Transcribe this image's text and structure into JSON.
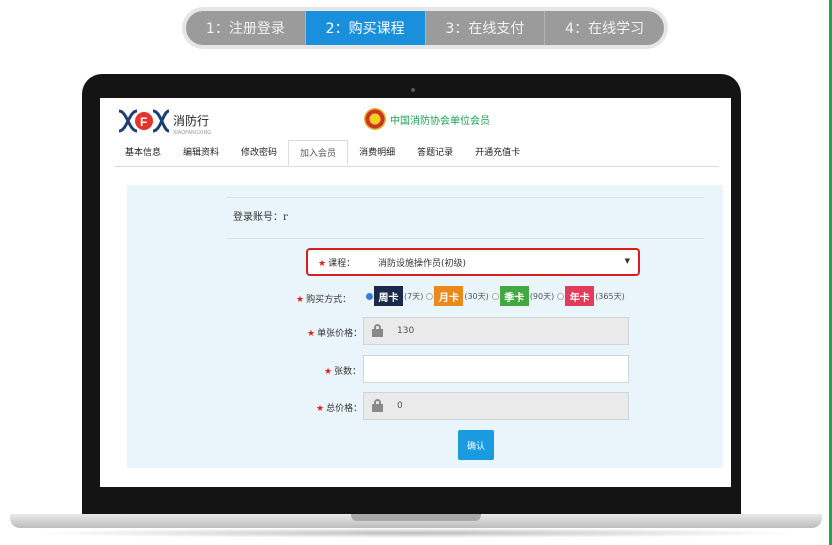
{
  "steps": [
    {
      "label": "1：注册登录"
    },
    {
      "label": "2：购买课程"
    },
    {
      "label": "3：在线支付"
    },
    {
      "label": "4：在线学习"
    }
  ],
  "site": {
    "logo_text": "消防行",
    "logo_sub": "XIAOFANGXING",
    "member_text": "中国消防协会单位会员"
  },
  "nav": {
    "tabs": [
      {
        "label": "基本信息"
      },
      {
        "label": "编辑资料"
      },
      {
        "label": "修改密码"
      },
      {
        "label": "加入会员"
      },
      {
        "label": "消费明细"
      },
      {
        "label": "答题记录"
      },
      {
        "label": "开通充值卡"
      }
    ]
  },
  "form": {
    "account_label": "登录账号：",
    "account_value": "r",
    "course_label": "课程：",
    "course_value": "消防设施操作员(初级)",
    "purchase_label": "购买方式：",
    "purchase_options": [
      {
        "card": "周卡",
        "duration": "(7天)"
      },
      {
        "card": "月卡",
        "duration": "(30天)"
      },
      {
        "card": "季卡",
        "duration": "(90天)"
      },
      {
        "card": "年卡",
        "duration": "(365天)"
      }
    ],
    "unit_price_label": "单张价格：",
    "unit_price_value": "130",
    "quantity_label": "张数：",
    "quantity_value": "",
    "total_label": "总价格：",
    "total_value": "0",
    "confirm_label": "确认",
    "required_mark": "★"
  },
  "colors": {
    "accent": "#1a8fdc",
    "required": "#e21b1b",
    "highlight_border": "#d81e1e",
    "member_green": "#1aa050"
  }
}
